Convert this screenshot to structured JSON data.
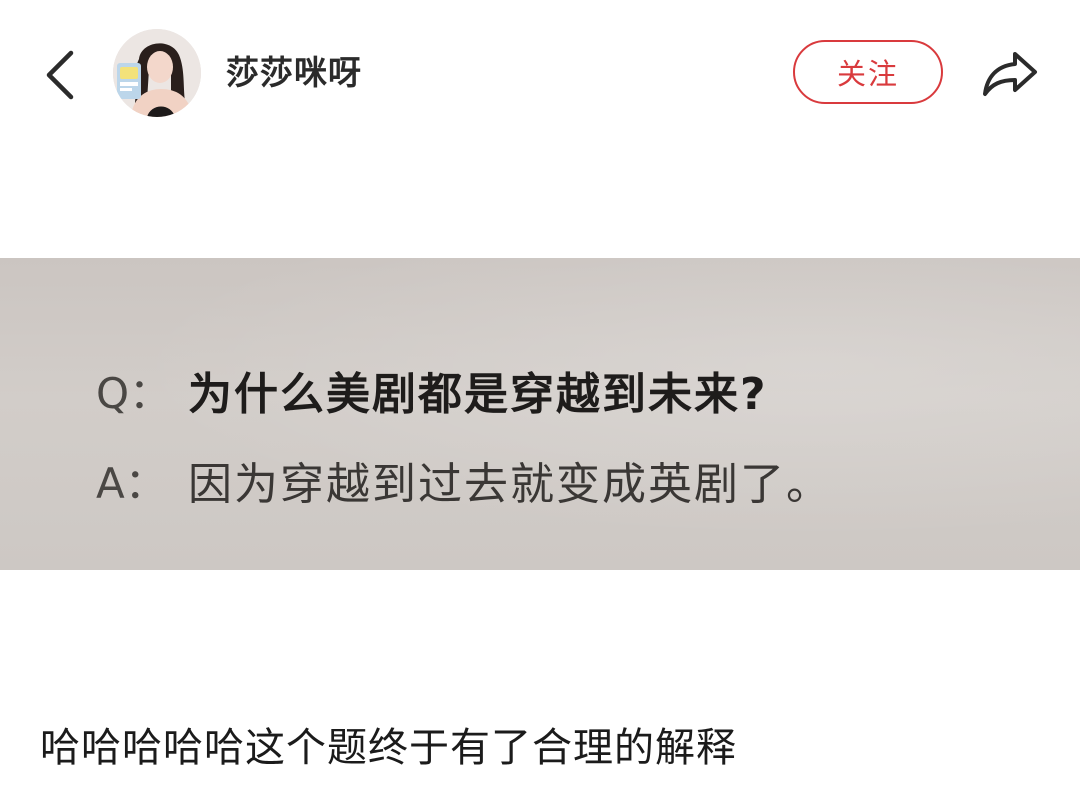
{
  "header": {
    "back_icon": "chevron-left-icon",
    "author_name": "莎莎咪呀",
    "follow_label": "关注",
    "share_icon": "share-arrow-icon",
    "accent_color": "#d93a3d"
  },
  "post": {
    "photo": {
      "question_prefix": "Q：",
      "question_text": "为什么美剧都是穿越到未来?",
      "answer_prefix": "A：",
      "answer_text": "因为穿越到过去就变成英剧了。"
    },
    "caption": "哈哈哈哈哈这个题终于有了合理的解释"
  }
}
